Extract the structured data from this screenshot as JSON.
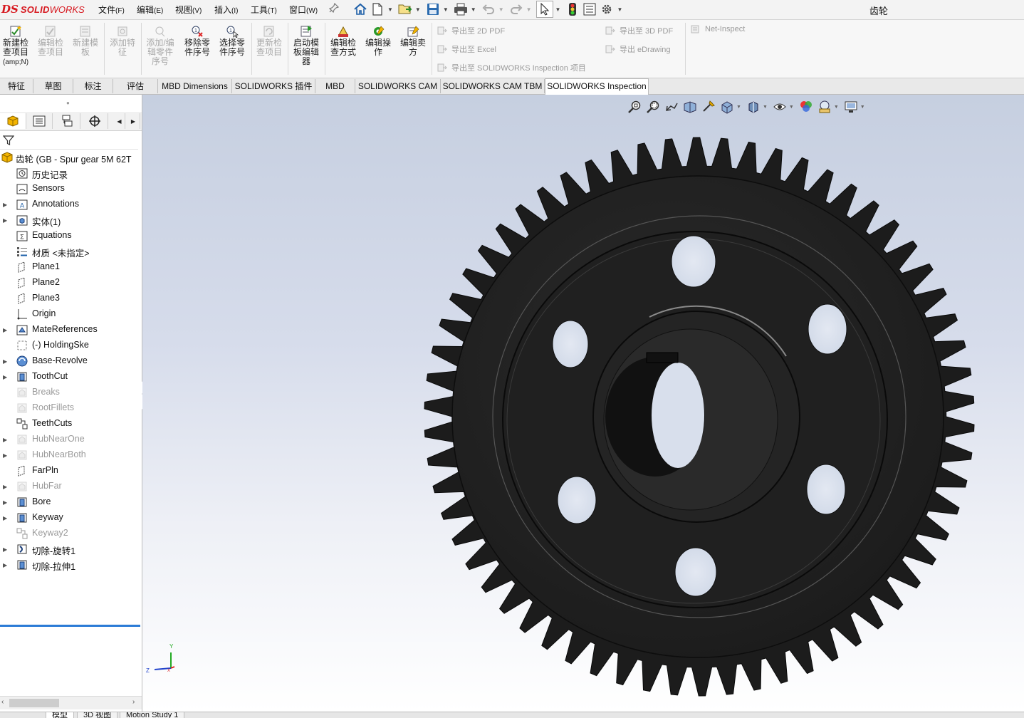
{
  "app": {
    "logo_mark": "DS",
    "logo_brand": "SOLID",
    "logo_brand2": "WORKS",
    "doc_title": "齿轮"
  },
  "menu": [
    {
      "label": "文件",
      "accel": "(F)"
    },
    {
      "label": "编辑",
      "accel": "(E)"
    },
    {
      "label": "视图",
      "accel": "(V)"
    },
    {
      "label": "插入",
      "accel": "(I)"
    },
    {
      "label": "工具",
      "accel": "(T)"
    },
    {
      "label": "窗口",
      "accel": "(W)"
    }
  ],
  "quick_access": [
    "home-icon",
    "new-document-icon",
    "open-icon",
    "save-icon",
    "print-icon",
    "undo-icon",
    "redo-icon",
    "select-icon",
    "rebuild-icon",
    "file-properties-icon",
    "options-icon"
  ],
  "commands": [
    {
      "label": "新建检查项目",
      "sub": "(amp;N)",
      "enabled": true
    },
    {
      "label": "编辑检查项目",
      "enabled": false
    },
    {
      "label": "新建模板",
      "enabled": false
    },
    {
      "label": "添加特征",
      "enabled": false
    },
    {
      "label": "添加/编辑零件序号",
      "enabled": false
    },
    {
      "label": "移除零件序号",
      "enabled": true
    },
    {
      "label": "选择零件序号",
      "enabled": true
    },
    {
      "label": "更新检查项目",
      "enabled": false
    },
    {
      "label": "启动模板编辑器",
      "enabled": true
    },
    {
      "label": "编辑检查方式",
      "enabled": true
    },
    {
      "label": "编辑操作",
      "enabled": true
    },
    {
      "label": "编辑卖方",
      "enabled": true
    }
  ],
  "exports": {
    "pdf2d": "导出至 2D PDF",
    "excel": "导出至 Excel",
    "inspection": "导出至 SOLIDWORKS Inspection 项目",
    "pdf3d": "导出至 3D PDF",
    "edrawing": "导出 eDrawing",
    "net_inspect": "Net-Inspect"
  },
  "tabs": [
    "特征",
    "草图",
    "标注",
    "评估",
    "MBD Dimensions",
    "SOLIDWORKS 插件",
    "MBD",
    "SOLIDWORKS CAM",
    "SOLIDWORKS CAM TBM",
    "SOLIDWORKS Inspection"
  ],
  "active_tab": "SOLIDWORKS Inspection",
  "tree": {
    "root": "齿轮  (GB - Spur gear 5M 62T",
    "items": [
      {
        "label": "历史记录",
        "icon": "history-folder-icon",
        "expandable": false,
        "suppressed": false
      },
      {
        "label": "Sensors",
        "icon": "sensors-folder-icon",
        "expandable": false,
        "suppressed": false
      },
      {
        "label": "Annotations",
        "icon": "annotations-folder-icon",
        "expandable": true,
        "suppressed": false
      },
      {
        "label": "实体(1)",
        "icon": "solid-bodies-folder-icon",
        "expandable": true,
        "suppressed": false
      },
      {
        "label": "Equations",
        "icon": "equations-folder-icon",
        "expandable": false,
        "suppressed": false
      },
      {
        "label": "材质 <未指定>",
        "icon": "material-icon",
        "expandable": false,
        "suppressed": false
      },
      {
        "label": "Plane1",
        "icon": "plane-icon",
        "expandable": false,
        "suppressed": false
      },
      {
        "label": "Plane2",
        "icon": "plane-icon",
        "expandable": false,
        "suppressed": false
      },
      {
        "label": "Plane3",
        "icon": "plane-icon",
        "expandable": false,
        "suppressed": false
      },
      {
        "label": "Origin",
        "icon": "origin-icon",
        "expandable": false,
        "suppressed": false
      },
      {
        "label": "MateReferences",
        "icon": "mate-references-icon",
        "expandable": true,
        "suppressed": false
      },
      {
        "label": "(-) HoldingSke",
        "icon": "sketch-icon",
        "expandable": false,
        "suppressed": false
      },
      {
        "label": "Base-Revolve",
        "icon": "revolve-icon",
        "expandable": true,
        "suppressed": false
      },
      {
        "label": "ToothCut",
        "icon": "cut-extrude-icon",
        "expandable": true,
        "suppressed": false
      },
      {
        "label": "Breaks",
        "icon": "feature-icon",
        "expandable": false,
        "suppressed": true
      },
      {
        "label": "RootFillets",
        "icon": "feature-icon",
        "expandable": false,
        "suppressed": true
      },
      {
        "label": "TeethCuts",
        "icon": "pattern-icon",
        "expandable": false,
        "suppressed": false
      },
      {
        "label": "HubNearOne",
        "icon": "feature-icon",
        "expandable": true,
        "suppressed": true
      },
      {
        "label": "HubNearBoth",
        "icon": "feature-icon",
        "expandable": true,
        "suppressed": true
      },
      {
        "label": "FarPln",
        "icon": "plane-icon",
        "expandable": false,
        "suppressed": false
      },
      {
        "label": "HubFar",
        "icon": "feature-icon",
        "expandable": true,
        "suppressed": true
      },
      {
        "label": "Bore",
        "icon": "cut-extrude-icon",
        "expandable": true,
        "suppressed": false
      },
      {
        "label": "Keyway",
        "icon": "cut-extrude-icon",
        "expandable": true,
        "suppressed": false
      },
      {
        "label": "Keyway2",
        "icon": "pattern-icon",
        "expandable": false,
        "suppressed": true
      },
      {
        "label": "切除-旋转1",
        "icon": "cut-revolve-icon",
        "expandable": true,
        "suppressed": false
      },
      {
        "label": "切除-拉伸1",
        "icon": "cut-extrude-icon",
        "expandable": true,
        "suppressed": false
      }
    ]
  },
  "bottom_tabs": [
    "模型",
    "3D 视图",
    "Motion Study 1"
  ],
  "triad": {
    "x": "X",
    "y": "Y",
    "z": "Z"
  },
  "colors": {
    "accent": "#2b7bd6",
    "brand": "#d71920",
    "part": "#1d1d1d"
  }
}
